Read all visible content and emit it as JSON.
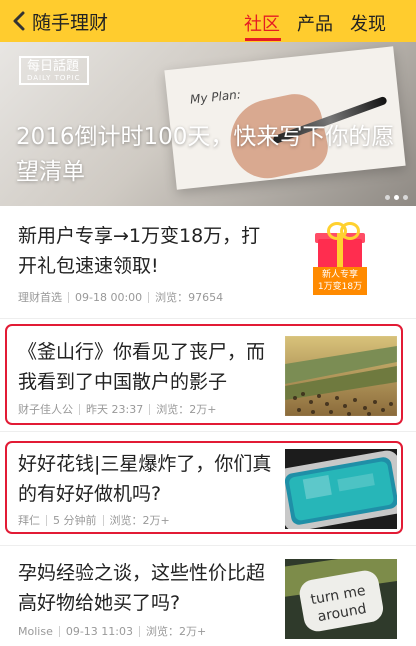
{
  "header": {
    "back_icon": "chevron-left-icon",
    "title": "随手理财",
    "tabs": [
      {
        "label": "社区",
        "active": true
      },
      {
        "label": "产品",
        "active": false
      },
      {
        "label": "发现",
        "active": false
      }
    ]
  },
  "banner": {
    "badge_main": "每日話題",
    "badge_sub": "DAILY TOPIC",
    "paper_text": "My Plan:",
    "title": "2016倒计时100天，快来写下你的愿望清单"
  },
  "items": [
    {
      "title": "新用户专享→1万变18万，打开礼包速速领取!",
      "source": "理财首选",
      "time": "09-18 00:00",
      "views": "浏览：97654",
      "gift_line1": "新人专享",
      "gift_line2": "1万变18万"
    },
    {
      "title": "《釜山行》你看见了丧尸，而我看到了中国散户的影子",
      "source": "财子佳人公",
      "time": "昨天 23:37",
      "views": "浏览：2万+"
    },
    {
      "title": "好好花钱|三星爆炸了，你们真的有好好做机吗?",
      "source": "拜仁",
      "time": "5 分钟前",
      "views": "浏览：2万+"
    },
    {
      "title": "孕妈经验之谈，这些性价比超高好物给她买了吗?",
      "source": "Molise",
      "time": "09-13 11:03",
      "views": "浏览：2万+"
    }
  ],
  "thumb_texts": {
    "pillow_line1": "turn me",
    "pillow_line2": "around"
  },
  "colors": {
    "header_bg": "#ffcc2e",
    "active_tab": "#e51c23",
    "highlight_border": "#e21b35",
    "meta_text": "#999999"
  }
}
